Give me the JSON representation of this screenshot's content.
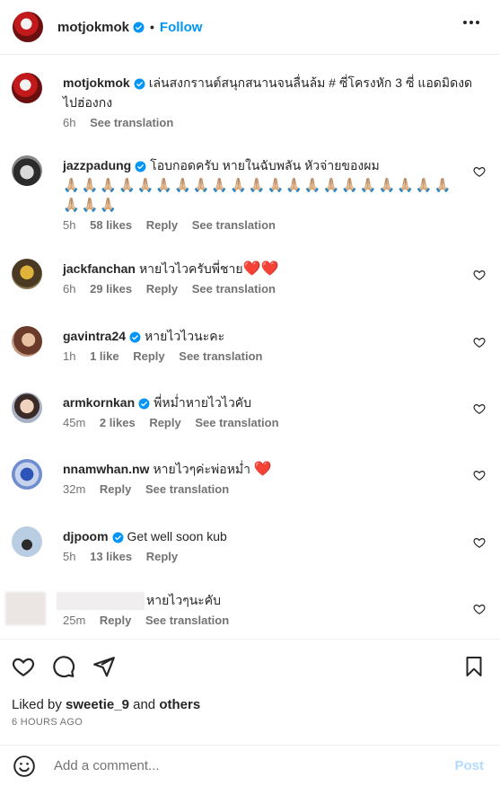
{
  "header": {
    "username": "motjokmok",
    "dot": "•",
    "follow_label": "Follow"
  },
  "caption": {
    "username": "motjokmok",
    "text": "เล่นสงกรานต์สนุกสนานจนลื่นล้ม # ซี่โครงหัก 3 ซี่ แอดมิดงดไปฮ่องกง",
    "time": "6h",
    "see_translation": "See translation"
  },
  "comments": [
    {
      "username": "jazzpadung",
      "text": "โอบกอดครับ หายในฉับพลัน หัวจ่ายของผม",
      "emoji": "🙏🏼🙏🏼🙏🏼🙏🏼🙏🏼🙏🏼🙏🏼🙏🏼🙏🏼🙏🏼🙏🏼🙏🏼🙏🏼🙏🏼🙏🏼🙏🏼🙏🏼🙏🏼🙏🏼🙏🏼🙏🏼🙏🏼🙏🏼🙏🏼",
      "time": "5h",
      "likes": "58 likes",
      "reply": "Reply",
      "see_translation": "See translation"
    },
    {
      "username": "jackfanchan",
      "text": "หายไวไวครับพี่ชาย",
      "emoji": "❤️❤️",
      "time": "6h",
      "likes": "29 likes",
      "reply": "Reply",
      "see_translation": "See translation"
    },
    {
      "username": "gavintra24",
      "text": "หายไวไวนะคะ",
      "time": "1h",
      "likes": "1 like",
      "reply": "Reply",
      "see_translation": "See translation"
    },
    {
      "username": "armkornkan",
      "text": "พี่หม่ำหายไวไวคับ",
      "time": "45m",
      "likes": "2 likes",
      "reply": "Reply",
      "see_translation": "See translation"
    },
    {
      "username": "nnamwhan.nw",
      "text": "หายไวๆค่ะพ่อหม่ำ",
      "emoji": "❤️",
      "time": "32m",
      "reply": "Reply",
      "see_translation": "See translation"
    },
    {
      "username": "djpoom",
      "text": "Get well soon kub",
      "time": "5h",
      "likes": "13 likes",
      "reply": "Reply"
    },
    {
      "text": "หายไวๆนะคับ",
      "time": "25m",
      "reply": "Reply",
      "see_translation": "See translation"
    }
  ],
  "liked_by": {
    "prefix": "Liked by",
    "user": "sweetie_9",
    "and": "and",
    "others": "others"
  },
  "post_time": "6 HOURS AGO",
  "add_comment": {
    "placeholder": "Add a comment...",
    "post_label": "Post"
  },
  "colors": {
    "accent": "#0095f6",
    "verified": "#0095f6",
    "post_disabled": "#b3dbff",
    "heart": "#e0001b"
  }
}
